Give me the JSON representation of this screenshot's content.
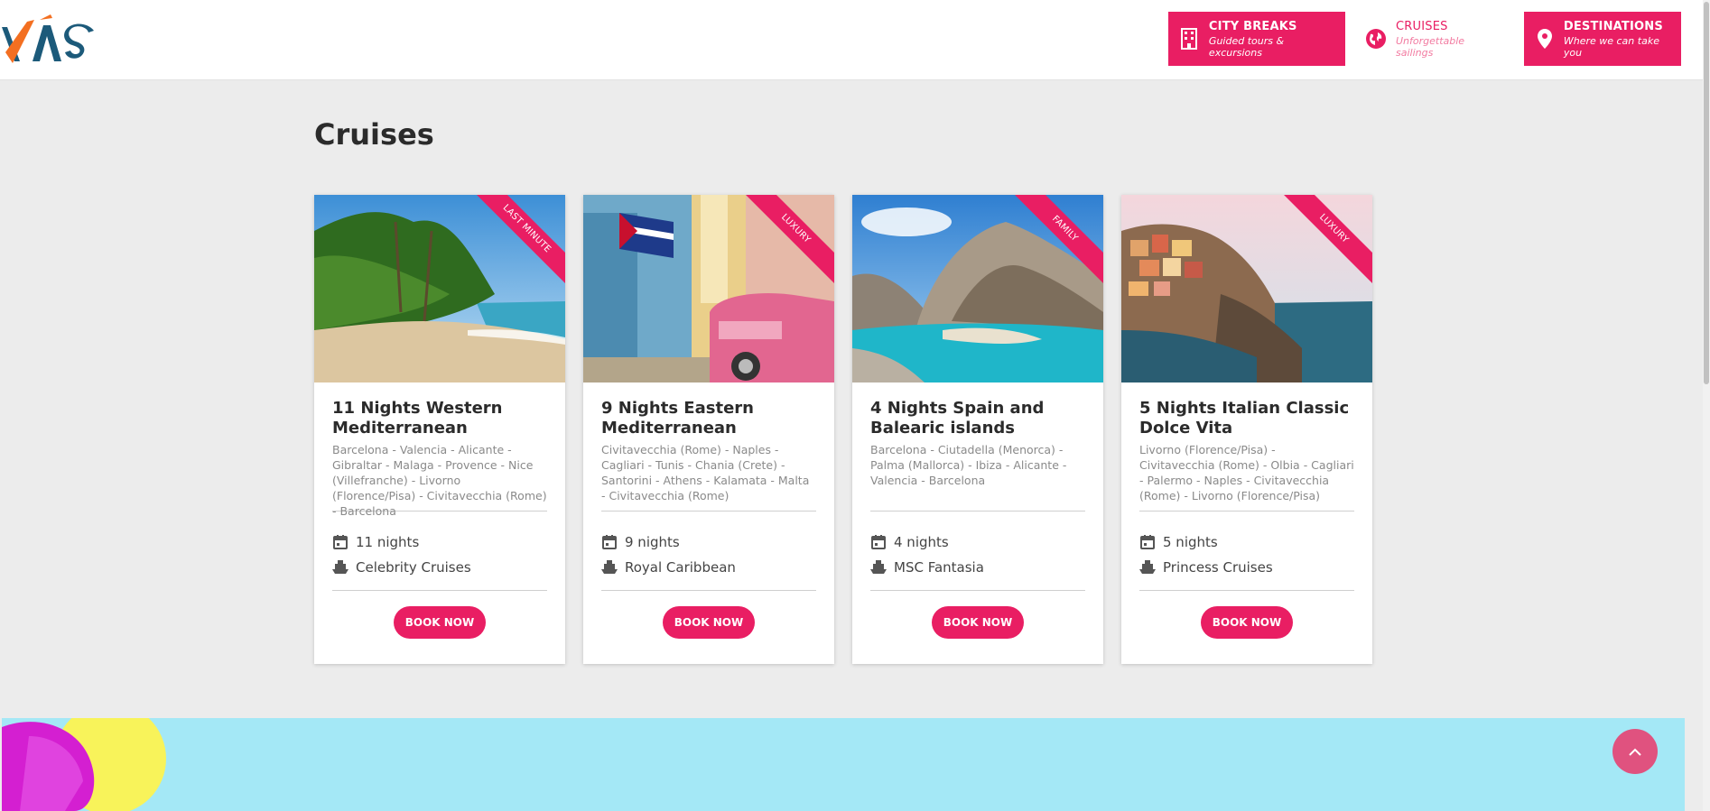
{
  "header": {
    "logo_text": "VÁS",
    "nav": [
      {
        "title": "CITY BREAKS",
        "subtitle": "Guided tours & excursions",
        "icon": "building-icon"
      },
      {
        "title": "CRUISES",
        "subtitle": "Unforgettable sailings",
        "icon": "globe-icon"
      },
      {
        "title": "DESTINATIONS",
        "subtitle": "Where we can take you",
        "icon": "location-pin-icon"
      }
    ]
  },
  "page": {
    "title": "Cruises"
  },
  "cards": [
    {
      "ribbon": "LAST MINUTE",
      "title": "11 Nights Western Mediterranean",
      "route": "Barcelona - Valencia - Alicante - Gibraltar - Malaga - Provence - Nice (Villefranche) - Livorno (Florence/Pisa) - Civitavecchia (Rome) - Barcelona",
      "nights": "11 nights",
      "cruise_line": "Celebrity Cruises",
      "cta": "BOOK NOW",
      "image": "tropical-beach"
    },
    {
      "ribbon": "LUXURY",
      "title": "9 Nights Eastern Mediterranean",
      "route": "Civitavecchia (Rome) - Naples - Cagliari - Tunis - Chania (Crete) - Santorini - Athens - Kalamata - Malta - Civitavecchia (Rome)",
      "nights": "9 nights",
      "cruise_line": "Royal Caribbean",
      "cta": "BOOK NOW",
      "image": "havana-street"
    },
    {
      "ribbon": "FAMILY",
      "title": "4 Nights Spain and Balearic islands",
      "route": "Barcelona - Ciutadella (Menorca) - Palma (Mallorca) - Ibiza - Alicante - Valencia - Barcelona",
      "nights": "4 nights",
      "cruise_line": "MSC Fantasia",
      "cta": "BOOK NOW",
      "image": "rocky-cove"
    },
    {
      "ribbon": "LUXURY",
      "title": "5 Nights Italian Classic Dolce Vita",
      "route": "Livorno (Florence/Pisa) - Civitavecchia (Rome) - Olbia - Cagliari - Palermo - Naples - Civitavecchia (Rome) - Livorno (Florence/Pisa)",
      "nights": "5 nights",
      "cruise_line": "Princess Cruises",
      "cta": "BOOK NOW",
      "image": "cliff-village"
    }
  ],
  "colors": {
    "accent": "#e91e63",
    "background": "#ececec",
    "banner": "#a4e8f6"
  }
}
